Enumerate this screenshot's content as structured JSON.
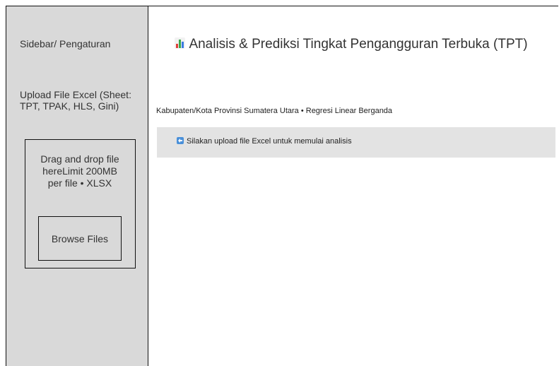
{
  "sidebar": {
    "title": "Sidebar/ Pengaturan",
    "upload_label": "Upload File Excel (Sheet: TPT, TPAK, HLS, Gini)",
    "dropzone_text": "Drag and drop file hereLimit 200MB per file • XLSX",
    "browse_label": "Browse Files"
  },
  "main": {
    "title_icon": "bar-chart-icon",
    "title": "Analisis & Prediksi Tingkat Pengangguran Terbuka (TPT)",
    "subtitle": "Kabupaten/Kota Provinsi Sumatera Utara • Regresi Linear Berganda",
    "info": {
      "icon": "left-arrow-icon",
      "text": "Silakan upload file Excel untuk memulai analisis"
    }
  },
  "colors": {
    "sidebar_bg": "#d9d9d9",
    "info_bg": "#e3e3e3",
    "chart_icon_red": "#e0403a",
    "chart_icon_green": "#3aa84a",
    "chart_icon_blue": "#3a7be0",
    "info_icon_blue": "#4a90d9"
  }
}
